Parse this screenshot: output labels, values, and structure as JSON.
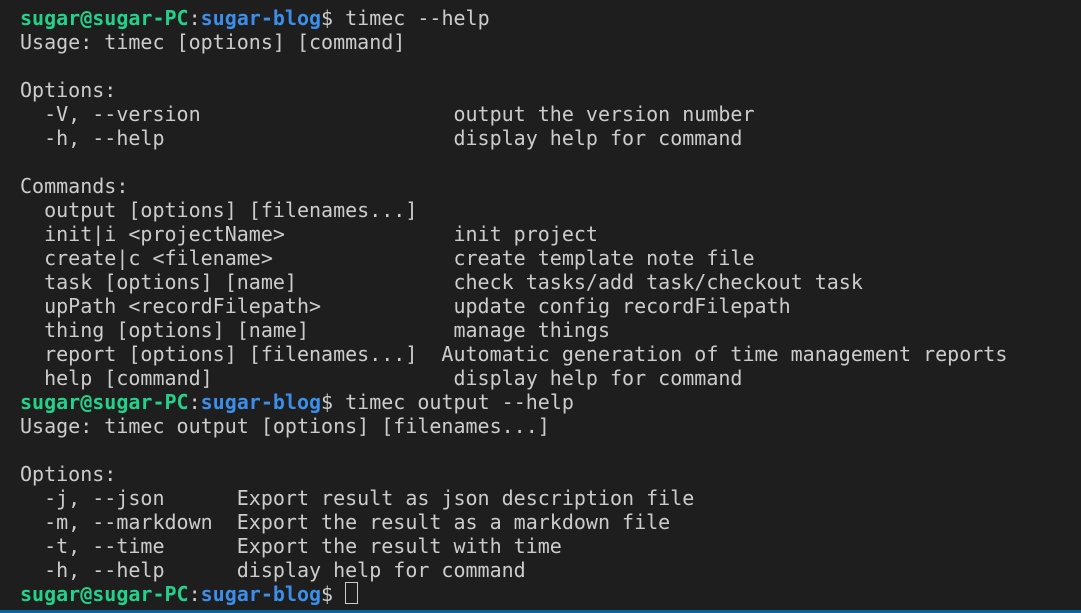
{
  "prompt": {
    "user": "sugar@sugar-PC",
    "colon": ":",
    "path": "sugar-blog",
    "symbol": "$"
  },
  "lines": [
    {
      "type": "prompt",
      "cmd": " timec --help"
    },
    {
      "type": "text",
      "text": "Usage: timec [options] [command]"
    },
    {
      "type": "text",
      "text": ""
    },
    {
      "type": "text",
      "text": "Options:"
    },
    {
      "type": "text",
      "text": "  -V, --version                     output the version number"
    },
    {
      "type": "text",
      "text": "  -h, --help                        display help for command"
    },
    {
      "type": "text",
      "text": ""
    },
    {
      "type": "text",
      "text": "Commands:"
    },
    {
      "type": "text",
      "text": "  output [options] [filenames...]"
    },
    {
      "type": "text",
      "text": "  init|i <projectName>              init project"
    },
    {
      "type": "text",
      "text": "  create|c <filename>               create template note file"
    },
    {
      "type": "text",
      "text": "  task [options] [name]             check tasks/add task/checkout task"
    },
    {
      "type": "text",
      "text": "  upPath <recordFilepath>           update config recordFilepath"
    },
    {
      "type": "text",
      "text": "  thing [options] [name]            manage things"
    },
    {
      "type": "text",
      "text": "  report [options] [filenames...]  Automatic generation of time management reports"
    },
    {
      "type": "text",
      "text": "  help [command]                    display help for command"
    },
    {
      "type": "prompt",
      "cmd": " timec output --help"
    },
    {
      "type": "text",
      "text": "Usage: timec output [options] [filenames...]"
    },
    {
      "type": "text",
      "text": ""
    },
    {
      "type": "text",
      "text": "Options:"
    },
    {
      "type": "text",
      "text": "  -j, --json      Export result as json description file"
    },
    {
      "type": "text",
      "text": "  -m, --markdown  Export the result as a markdown file"
    },
    {
      "type": "text",
      "text": "  -t, --time      Export the result with time"
    },
    {
      "type": "text",
      "text": "  -h, --help      display help for command"
    },
    {
      "type": "prompt",
      "cmd": " ",
      "cursor": true
    }
  ]
}
